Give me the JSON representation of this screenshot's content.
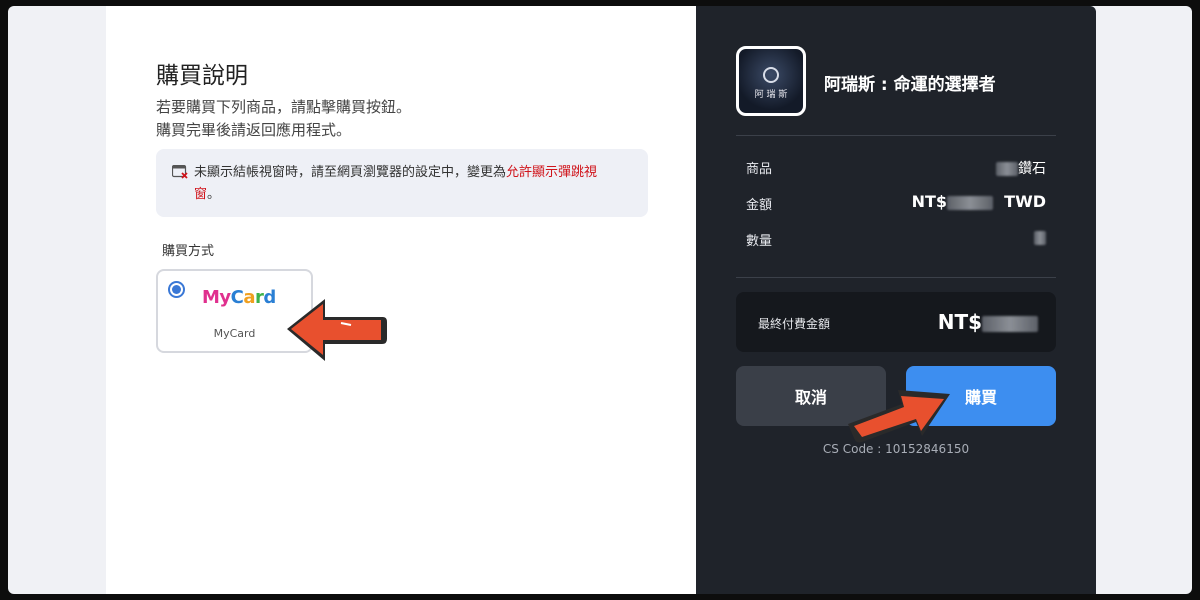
{
  "left": {
    "title": "購買說明",
    "intro_line1": "若要購買下列商品，請點擊購買按鈕。",
    "intro_line2": "購買完畢後請返回應用程式。",
    "notice_text": "未顯示結帳視窗時，請至網頁瀏覽器的設定中，變更為",
    "notice_link": "允許顯示彈跳視",
    "notice_link_end": "窗",
    "notice_period": "。",
    "payment_method_label": "購買方式",
    "payment_option": {
      "logo_text": "MyCard",
      "name": "MyCard",
      "selected": true
    }
  },
  "right": {
    "game_logo_text": "阿 瑞 斯",
    "game_title": "阿瑞斯 : 命運的選擇者",
    "rows": [
      {
        "label": "商品",
        "value": "鑽石"
      },
      {
        "label": "金額",
        "value_prefix": "NT$",
        "value_suffix": "TWD"
      },
      {
        "label": "數量",
        "value": ""
      }
    ],
    "total_label": "最終付費金額",
    "total_prefix": "NT$",
    "cancel_label": "取消",
    "buy_label": "購買",
    "cs_code": "CS Code : 10152846150"
  },
  "colors": {
    "accent_blue": "#3d8ef0",
    "dark_panel": "#1f232a",
    "notice_link": "#d0141b",
    "arrow_red": "#e8502e"
  },
  "icons": [
    "popup-blocked-icon",
    "pointer-arrow-icon",
    "game-emblem-icon"
  ]
}
